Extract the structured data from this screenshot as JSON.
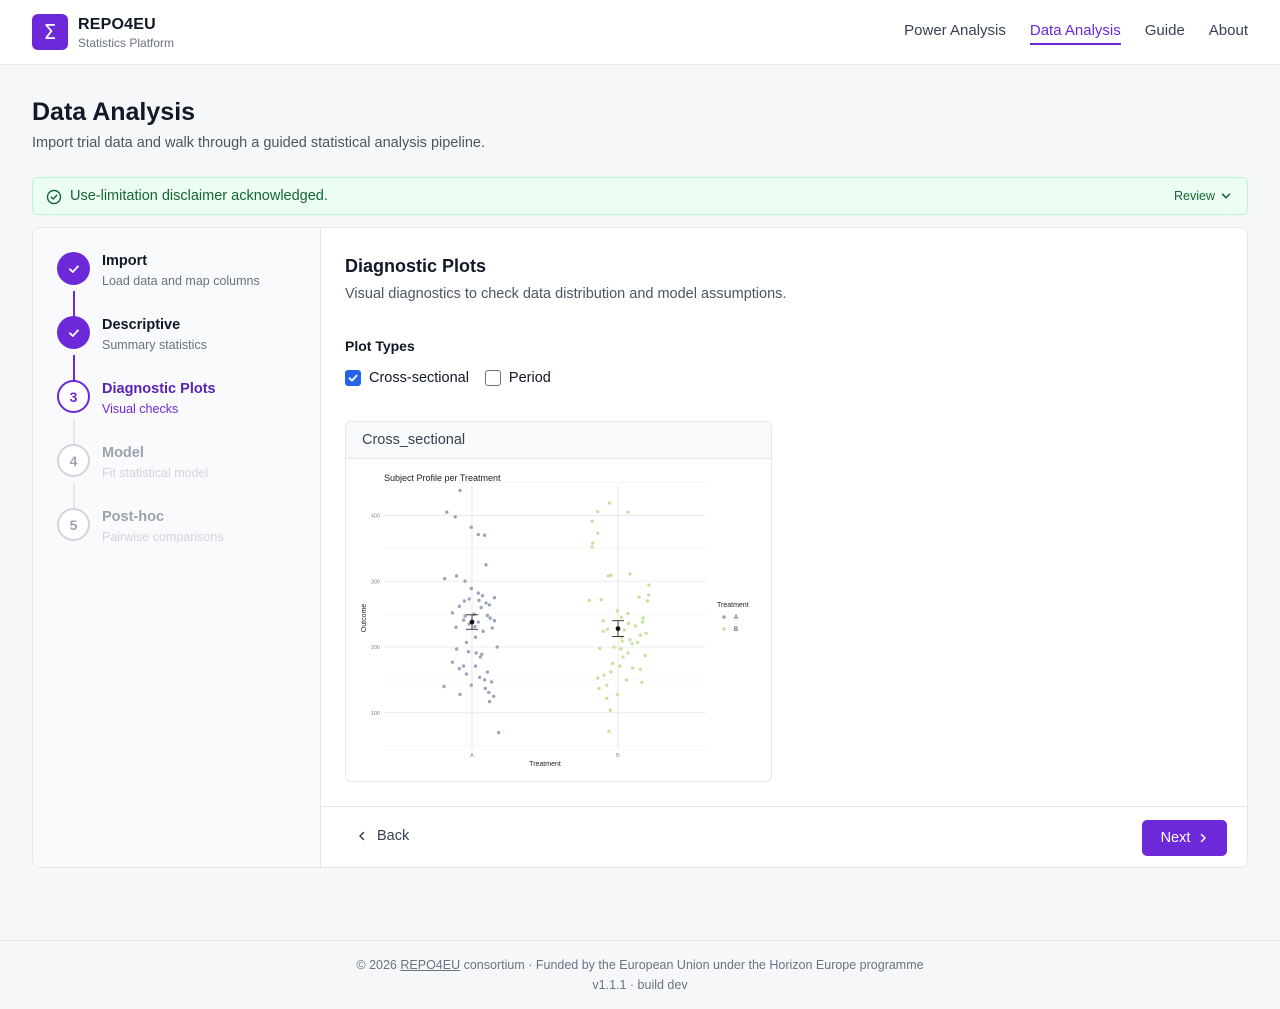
{
  "header": {
    "logo_glyph": "Σ",
    "brand_name": "REPO4EU",
    "brand_sub": "Statistics Platform",
    "nav": [
      {
        "label": "Power Analysis",
        "active": false
      },
      {
        "label": "Data Analysis",
        "active": true
      },
      {
        "label": "Guide",
        "active": false
      },
      {
        "label": "About",
        "active": false
      }
    ]
  },
  "page": {
    "title": "Data Analysis",
    "subtitle": "Import trial data and walk through a guided statistical analysis pipeline."
  },
  "notice": {
    "text": "Use-limitation disclaimer acknowledged.",
    "action": "Review",
    "icon": "check-circle-icon"
  },
  "steps": [
    {
      "number": "1",
      "title": "Import",
      "desc": "Load data and map columns",
      "state": "done"
    },
    {
      "number": "2",
      "title": "Descriptive",
      "desc": "Summary statistics",
      "state": "done"
    },
    {
      "number": "3",
      "title": "Diagnostic Plots",
      "desc": "Visual checks",
      "state": "current"
    },
    {
      "number": "4",
      "title": "Model",
      "desc": "Fit statistical model",
      "state": "todo"
    },
    {
      "number": "5",
      "title": "Post-hoc",
      "desc": "Pairwise comparisons",
      "state": "todo"
    }
  ],
  "section": {
    "title": "Diagnostic Plots",
    "subtitle": "Visual diagnostics to check data distribution and model assumptions.",
    "plot_types_label": "Plot Types",
    "options": [
      {
        "label": "Cross-sectional",
        "checked": true
      },
      {
        "label": "Period",
        "checked": false
      }
    ],
    "plot_card_title": "Cross_sectional"
  },
  "chart_data": {
    "type": "scatter",
    "title": "Subject Profile per Treatment",
    "xlabel": "Treatment",
    "ylabel": "Outcome",
    "categories": [
      "A",
      "B"
    ],
    "ylim": [
      45,
      460
    ],
    "yticks": [
      100,
      200,
      300,
      400
    ],
    "grid": true,
    "legend": {
      "title": "Treatment",
      "placement": "right",
      "entries": [
        "A",
        "B"
      ]
    },
    "colors": {
      "A": "#9aa5bf",
      "B": "#c7e3a0"
    },
    "series": [
      {
        "name": "A",
        "points": [
          [
            -0.17,
            438
          ],
          [
            -0.36,
            405
          ],
          [
            -0.24,
            398
          ],
          [
            -0.01,
            382
          ],
          [
            0.09,
            371
          ],
          [
            0.18,
            370
          ],
          [
            0.2,
            325
          ],
          [
            -0.22,
            308
          ],
          [
            -0.39,
            304
          ],
          [
            -0.1,
            300
          ],
          [
            -0.01,
            289
          ],
          [
            0.09,
            282
          ],
          [
            0.15,
            278
          ],
          [
            0.32,
            275
          ],
          [
            -0.04,
            273
          ],
          [
            0.1,
            271
          ],
          [
            -0.11,
            270
          ],
          [
            0.2,
            267
          ],
          [
            0.25,
            264
          ],
          [
            -0.18,
            262
          ],
          [
            0.13,
            260
          ],
          [
            -0.28,
            252
          ],
          [
            0.03,
            250
          ],
          [
            0.22,
            248
          ],
          [
            -0.1,
            247
          ],
          [
            0.26,
            244
          ],
          [
            -0.12,
            241
          ],
          [
            0.32,
            240
          ],
          [
            0.09,
            238
          ],
          [
            -0.04,
            235
          ],
          [
            0.04,
            231
          ],
          [
            -0.23,
            230
          ],
          [
            0.29,
            229
          ],
          [
            0.16,
            224
          ],
          [
            0.05,
            215
          ],
          [
            -0.08,
            207
          ],
          [
            0.36,
            200
          ],
          [
            -0.22,
            197
          ],
          [
            -0.05,
            193
          ],
          [
            0.06,
            191
          ],
          [
            0.14,
            189
          ],
          [
            0.12,
            185
          ],
          [
            -0.28,
            177
          ],
          [
            -0.12,
            171
          ],
          [
            0.05,
            171
          ],
          [
            -0.18,
            167
          ],
          [
            0.22,
            162
          ],
          [
            -0.08,
            159
          ],
          [
            0.11,
            154
          ],
          [
            0.18,
            150
          ],
          [
            0.28,
            147
          ],
          [
            -0.01,
            142
          ],
          [
            -0.4,
            140
          ],
          [
            0.19,
            137
          ],
          [
            0.24,
            131
          ],
          [
            -0.17,
            128
          ],
          [
            0.31,
            125
          ],
          [
            0.25,
            117
          ],
          [
            0.38,
            70
          ]
        ],
        "mean": 238,
        "error": [
          227,
          249
        ]
      },
      {
        "name": "B",
        "points": [
          [
            -0.12,
            419
          ],
          [
            -0.29,
            406
          ],
          [
            -0.37,
            391
          ],
          [
            -0.29,
            373
          ],
          [
            -0.36,
            358
          ],
          [
            -0.37,
            352
          ],
          [
            -0.1,
            309
          ],
          [
            -0.14,
            308
          ],
          [
            0.17,
            311
          ],
          [
            0.44,
            294
          ],
          [
            0.44,
            279
          ],
          [
            0.3,
            276
          ],
          [
            -0.24,
            272
          ],
          [
            -0.41,
            271
          ],
          [
            0.42,
            270
          ],
          [
            -0.01,
            255
          ],
          [
            0.14,
            251
          ],
          [
            0.05,
            245
          ],
          [
            0.36,
            244
          ],
          [
            -0.21,
            240
          ],
          [
            0.35,
            238
          ],
          [
            0.15,
            236
          ],
          [
            0.25,
            232
          ],
          [
            -0.15,
            227
          ],
          [
            0.09,
            226
          ],
          [
            -0.21,
            224
          ],
          [
            0.4,
            221
          ],
          [
            0.32,
            218
          ],
          [
            0.05,
            215
          ],
          [
            0.17,
            211
          ],
          [
            0.06,
            209
          ],
          [
            0.28,
            207
          ],
          [
            0.2,
            205
          ],
          [
            -0.06,
            200
          ],
          [
            -0.26,
            198
          ],
          [
            0.04,
            197
          ],
          [
            0.14,
            191
          ],
          [
            0.39,
            187
          ],
          [
            0.07,
            185
          ],
          [
            -0.08,
            175
          ],
          [
            0.03,
            171
          ],
          [
            0.21,
            168
          ],
          [
            0.32,
            166
          ],
          [
            -0.1,
            162
          ],
          [
            -0.2,
            157
          ],
          [
            -0.29,
            153
          ],
          [
            0.12,
            150
          ],
          [
            0.34,
            146
          ],
          [
            -0.16,
            142
          ],
          [
            -0.27,
            137
          ],
          [
            -0.01,
            128
          ],
          [
            -0.16,
            122
          ],
          [
            -0.11,
            104
          ],
          [
            -0.13,
            72
          ],
          [
            0.14,
            405
          ]
        ],
        "mean": 228,
        "error": [
          216,
          240
        ]
      }
    ]
  },
  "nav_buttons": {
    "back": "Back",
    "next": "Next"
  },
  "footer": {
    "copyright_prefix": "© 2026",
    "link": "REPO4EU",
    "copyright_suffix": "consortium · Funded by the European Union under the Horizon Europe programme",
    "version": "v1.1.1 · build dev"
  }
}
